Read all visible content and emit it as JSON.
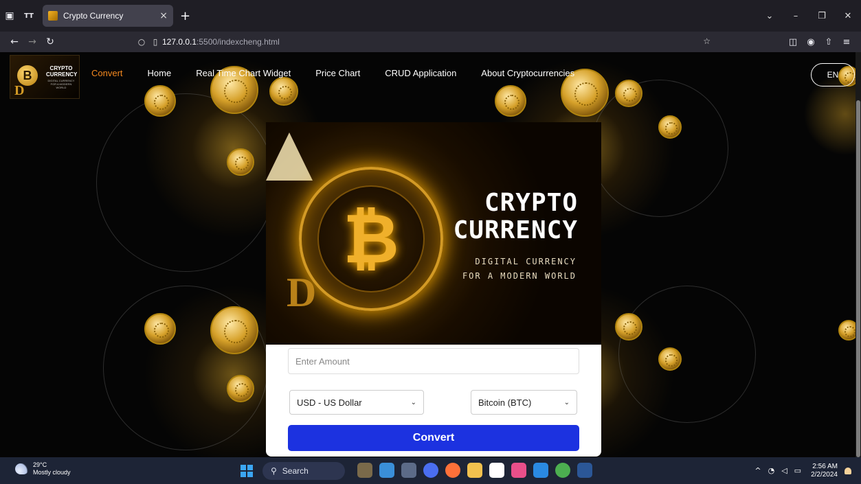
{
  "browser": {
    "tab_title": "Crypto Currency",
    "url_host": "127.0.0.1",
    "url_path": ":5500/indexcheng.html"
  },
  "site": {
    "logo_title": "CRYPTO CURRENCY",
    "logo_sub": "DIGITAL CURRENCY FOR A MODERN WORLD",
    "menu": [
      {
        "label": "Convert"
      },
      {
        "label": "Home"
      },
      {
        "label": "Real Time Chart Widget"
      },
      {
        "label": "Price Chart"
      },
      {
        "label": "CRUD Application"
      },
      {
        "label": "About Cryptocurrencies"
      }
    ],
    "lang": "EN"
  },
  "hero": {
    "title_line1": "CRYPTO",
    "title_line2": "CURRENCY",
    "sub_line1": "DIGITAL CURRENCY",
    "sub_line2": "FOR A MODERN WORLD"
  },
  "form": {
    "amount_placeholder": "Enter Amount",
    "from_currency": "USD - US Dollar",
    "to_currency": "Bitcoin (BTC)",
    "convert_label": "Convert"
  },
  "taskbar": {
    "temperature": "29°C",
    "weather": "Mostly cloudy",
    "search": "Search",
    "time": "2:56 AM",
    "date": "2/2/2024"
  },
  "colors": {
    "accent_active": "#f5891f",
    "convert_button": "#1c32e0",
    "gold": "#d39a25"
  }
}
